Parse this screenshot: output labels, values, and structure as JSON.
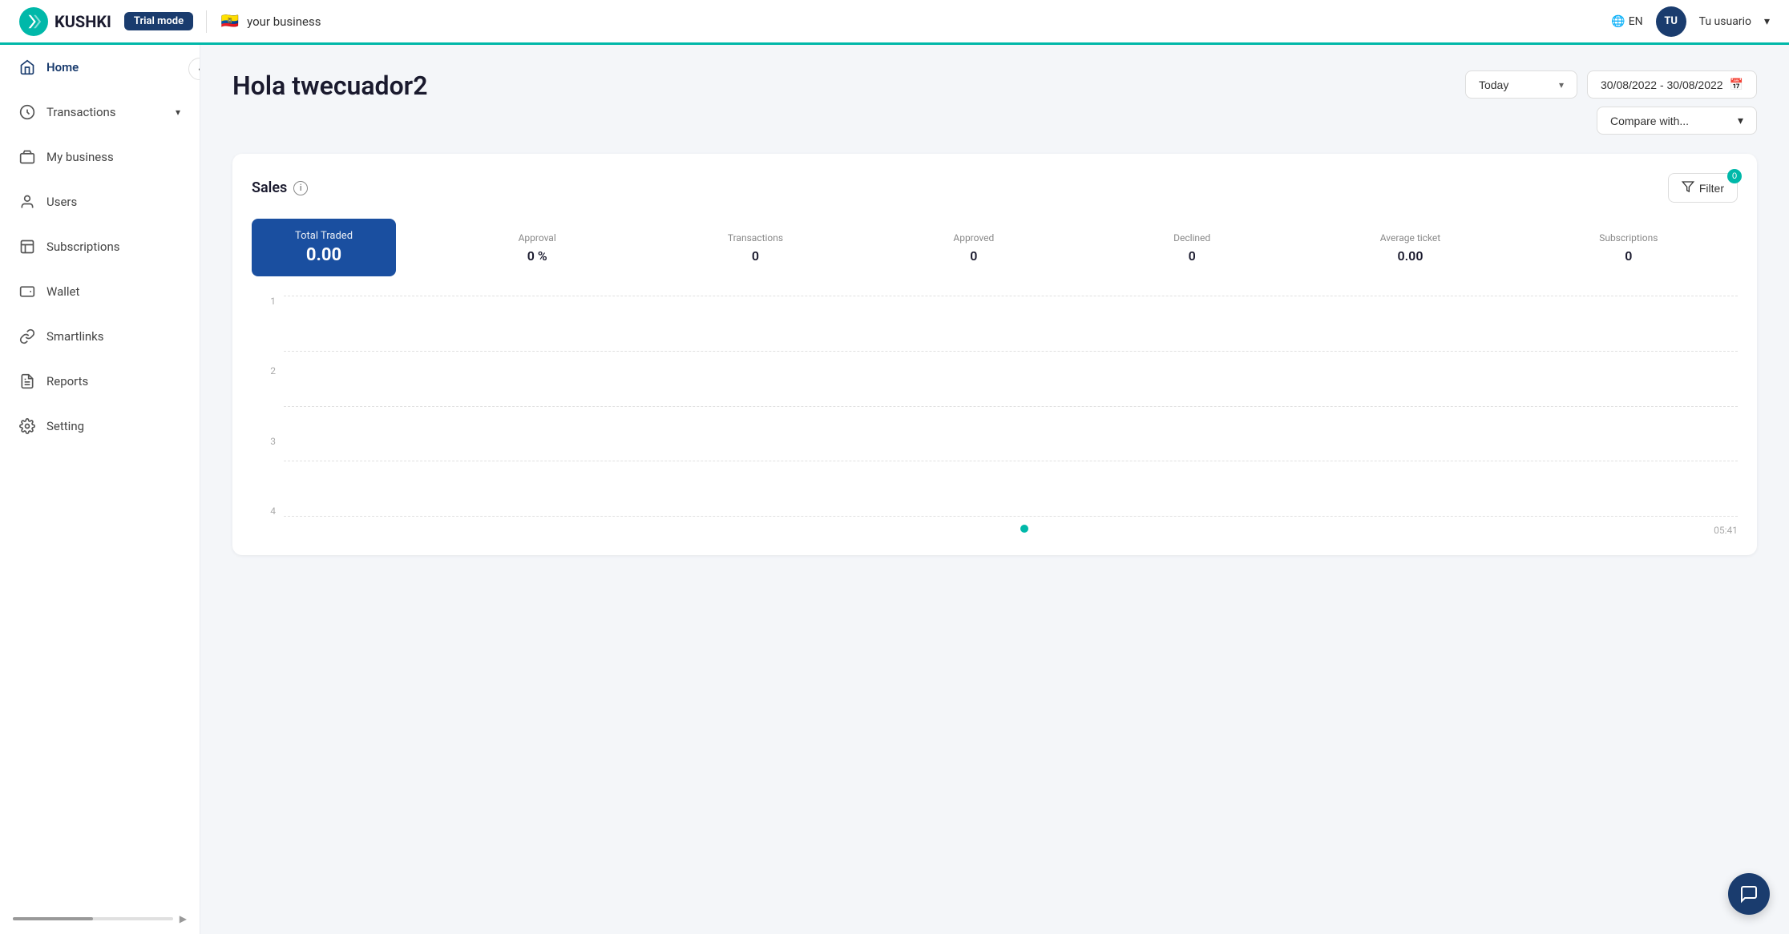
{
  "topbar": {
    "logo_text": "KUSHKI",
    "trial_label": "Trial mode",
    "business_name": "your business",
    "lang": "EN",
    "user_initials": "TU",
    "user_name": "Tu usuario"
  },
  "sidebar": {
    "toggle_icon": "‹",
    "items": [
      {
        "id": "home",
        "label": "Home",
        "icon": "🏠",
        "has_chevron": false
      },
      {
        "id": "transactions",
        "label": "Transactions",
        "icon": "💲",
        "has_chevron": true
      },
      {
        "id": "my-business",
        "label": "My business",
        "icon": "🏪",
        "has_chevron": false
      },
      {
        "id": "users",
        "label": "Users",
        "icon": "👤",
        "has_chevron": false
      },
      {
        "id": "subscriptions",
        "label": "Subscriptions",
        "icon": "📊",
        "has_chevron": false
      },
      {
        "id": "wallet",
        "label": "Wallet",
        "icon": "💳",
        "has_chevron": false
      },
      {
        "id": "smartlinks",
        "label": "Smartlinks",
        "icon": "🔗",
        "has_chevron": false
      },
      {
        "id": "reports",
        "label": "Reports",
        "icon": "📋",
        "has_chevron": false
      },
      {
        "id": "setting",
        "label": "Setting",
        "icon": "⚙️",
        "has_chevron": false
      }
    ]
  },
  "page": {
    "title": "Hola twecuador2",
    "period_dropdown": "Today",
    "date_range": "30/08/2022 - 30/08/2022",
    "compare_label": "Compare with...",
    "sales_section_label": "Sales",
    "filter_label": "Filter",
    "filter_count": "0"
  },
  "metrics": {
    "total_traded_label": "Total Traded",
    "total_traded_value": "0.00",
    "approval_label": "Approval",
    "approval_value": "0 %",
    "transactions_label": "Transactions",
    "transactions_value": "0",
    "approved_label": "Approved",
    "approved_value": "0",
    "declined_label": "Declined",
    "declined_value": "0",
    "avg_ticket_label": "Average ticket",
    "avg_ticket_value": "0.00",
    "subscriptions_label": "Subscriptions",
    "subscriptions_value": "0"
  },
  "chart": {
    "y_labels": [
      "1",
      "2",
      "3",
      "4"
    ],
    "x_label": "05:41",
    "dot_x_pct": 52,
    "dot_y_pct": 97
  }
}
